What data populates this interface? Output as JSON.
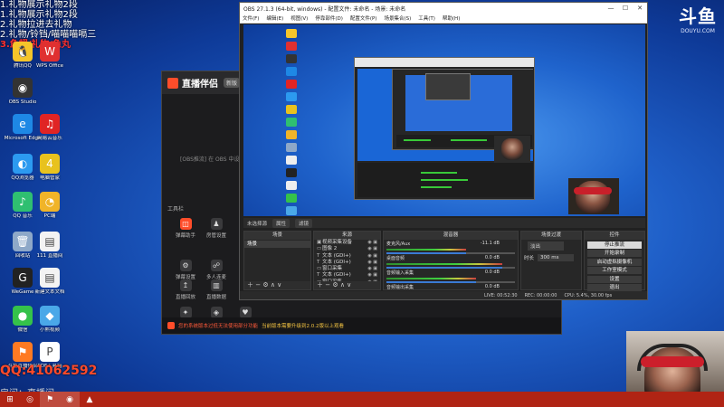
{
  "overlay": {
    "lines": [
      {
        "text": "1.礼物展示礼物2段",
        "red": false
      },
      {
        "text": "1.礼物展示礼物2段",
        "red": false
      },
      {
        "text": "2.礼物拉进去礼物",
        "red": false
      },
      {
        "text": "2.礼物/铃铛/喵喵喵嗝三",
        "red": false
      },
      {
        "text": "3.鱼翅/礼物/鱼丸",
        "red": true
      }
    ],
    "qq": "QQ:41062592",
    "room": "房间：直播间"
  },
  "douyu": {
    "logo": "斗鱼",
    "url": "DOUYU.COM"
  },
  "desktop_icons": [
    {
      "id": "tencent-qq",
      "label": "腾讯QQ",
      "glyph": "🐧",
      "color": "#f5c52a"
    },
    {
      "id": "wps",
      "label": "WPS Office",
      "glyph": "W",
      "color": "#e03030"
    },
    {
      "id": "obs",
      "label": "OBS Studio",
      "glyph": "◉",
      "color": "#333333"
    },
    {
      "id": "wechat-web",
      "label": "Microsoft Edge",
      "glyph": "e",
      "color": "#1e88e5"
    },
    {
      "id": "netease",
      "label": "网易云音乐",
      "glyph": "♫",
      "color": "#e02424"
    },
    {
      "id": "qq-browser",
      "label": "QQ浏览器",
      "glyph": "◐",
      "color": "#2c9af0"
    },
    {
      "id": "pc-manager",
      "label": "电脑管家",
      "glyph": "4",
      "color": "#e8c21e"
    },
    {
      "id": "qq-music",
      "label": "QQ 音乐",
      "glyph": "♪",
      "color": "#2fbf71"
    },
    {
      "id": "huya",
      "label": "PC端",
      "glyph": "◔",
      "color": "#f0b429"
    },
    {
      "id": "recycle",
      "label": "回收站",
      "glyph": "🗑",
      "color": "#8ea8c8"
    },
    {
      "id": "doc1",
      "label": "111 直播间",
      "glyph": "▤",
      "color": "#f3f3f3"
    },
    {
      "id": "wegame",
      "label": "WeGame",
      "glyph": "G",
      "color": "#222222"
    },
    {
      "id": "doc2",
      "label": "新建文本文档",
      "glyph": "▤",
      "color": "#f3f3f3"
    },
    {
      "id": "wechat",
      "label": "微信",
      "glyph": "●",
      "color": "#35c24a"
    },
    {
      "id": "video",
      "label": "小熊视频",
      "glyph": "◆",
      "color": "#4aa8e8"
    },
    {
      "id": "zhibo",
      "label": "斗鱼直播伴侣",
      "glyph": "⚑",
      "color": "#ff7a22"
    },
    {
      "id": "pdf",
      "label": "PDF工具箱",
      "glyph": "P",
      "color": "#ffffff"
    }
  ],
  "zbbl": {
    "title": "直播伴侣",
    "version": "新版",
    "hint": "[OBS推流] 在 OBS 中设置好推流地址后即可开播",
    "tools_title": "工具栏",
    "tools": [
      {
        "label": "弹幕助手",
        "glyph": "◫",
        "hot": true
      },
      {
        "label": "房管设置",
        "glyph": "♟",
        "hot": false
      },
      {
        "label": "主题",
        "glyph": "▦",
        "hot": false
      },
      {
        "label": "弹幕设置",
        "glyph": "⚙",
        "hot": false
      },
      {
        "label": "多人连麦",
        "glyph": "☍",
        "hot": false
      },
      {
        "label": "直播回放",
        "glyph": "↥",
        "hot": false
      },
      {
        "label": "直播数据",
        "glyph": "▥",
        "hot": false
      },
      {
        "label": "直播助手",
        "glyph": "✦",
        "hot": false
      },
      {
        "label": "PK",
        "glyph": "◈",
        "hot": false
      },
      {
        "label": "粉丝团",
        "glyph": "♥",
        "hot": false
      }
    ],
    "footer_warn": "您的系统版本过低无法使用部分功能",
    "footer_update": "当前版本需要升级到2.0.2版以上观看"
  },
  "obs": {
    "title": "OBS 27.1.3 (64-bit, windows) - 配置文件: 未命名 - 场景: 未命名",
    "window_controls": [
      "—",
      "☐",
      "✕"
    ],
    "menu": [
      "文件(F)",
      "编辑(E)",
      "视图(V)",
      "停靠部件(D)",
      "配置文件(P)",
      "场景集合(S)",
      "工具(T)",
      "帮助(H)"
    ],
    "toolbar_label": "未选择源",
    "toolbar_tabs": [
      "属性",
      "滤镜"
    ],
    "docks": {
      "scenes": {
        "title": "场景",
        "items": [
          "场景"
        ]
      },
      "sources": {
        "title": "来源",
        "items": [
          {
            "icon": "▣",
            "name": "视频采集设备"
          },
          {
            "icon": "▭",
            "name": "图像 2"
          },
          {
            "icon": "T",
            "name": "文本 (GDI+)"
          },
          {
            "icon": "T",
            "name": "文本 (GDI+)"
          },
          {
            "icon": "▭",
            "name": "窗口采集"
          },
          {
            "icon": "T",
            "name": "文本 (GDI+)"
          },
          {
            "icon": "▭",
            "name": "窗口采集"
          }
        ]
      },
      "mixer": {
        "title": "混音器",
        "channels": [
          {
            "name": "麦克风/Aux",
            "db": "-11.1 dB",
            "level": 0.62
          },
          {
            "name": "桌面音频",
            "db": "0.0 dB",
            "level": 0.9
          },
          {
            "name": "音频输入采集",
            "db": "0.0 dB",
            "level": 0.7
          },
          {
            "name": "音频输出采集",
            "db": "0.0 dB",
            "level": 0.8
          }
        ]
      },
      "transitions": {
        "title": "场景过渡",
        "type": "淡出",
        "duration_label": "时长",
        "duration": "300 ms"
      },
      "controls": {
        "title": "控件",
        "buttons": [
          {
            "label": "停止推流",
            "on": true
          },
          {
            "label": "开始录制",
            "on": false
          },
          {
            "label": "启动虚拟摄像机",
            "on": false
          },
          {
            "label": "工作室模式",
            "on": false
          },
          {
            "label": "设置",
            "on": false
          },
          {
            "label": "退出",
            "on": false
          }
        ]
      }
    },
    "status": [
      "LIVE: 00:52:30",
      "REC: 00:00:00",
      "CPU: 5.4%, 30.00 fps"
    ]
  },
  "taskbar": {
    "items": [
      {
        "glyph": "⊞",
        "active": false
      },
      {
        "glyph": "◎",
        "active": false
      },
      {
        "glyph": "⚑",
        "active": true
      },
      {
        "glyph": "◉",
        "active": true
      },
      {
        "glyph": "▲",
        "active": false
      }
    ]
  }
}
